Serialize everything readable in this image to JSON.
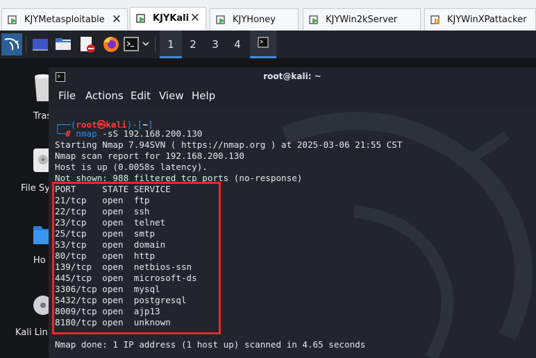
{
  "vm_tabs": [
    {
      "label": "KJYMetasploitable",
      "active": false
    },
    {
      "label": "KJYKali",
      "active": true
    },
    {
      "label": "KJYHoney",
      "active": false
    },
    {
      "label": "KJYWin2kServer",
      "active": false
    },
    {
      "label": "KJYWinXPattacker",
      "active": false
    }
  ],
  "close_glyph": "✕",
  "workspaces": [
    "1",
    "2",
    "3",
    "4"
  ],
  "desktop": {
    "icons": [
      {
        "label": "Trash"
      },
      {
        "label": "File Sys"
      },
      {
        "label": "Ho"
      },
      {
        "label": "Kali Lin"
      }
    ]
  },
  "terminal": {
    "title": "root@kali: ~",
    "menu": [
      "File",
      "Actions",
      "Edit",
      "View",
      "Help"
    ],
    "prompt": {
      "open": "┌──(",
      "user": "root",
      "at": "㉿",
      "host": "kali",
      "close": ")-[",
      "dir": "~",
      "end": "]",
      "line2": "└─",
      "hash": "#",
      "cmd": "nmap",
      "args": "-sS 192.168.200.130"
    },
    "output": [
      "Starting Nmap 7.94SVN ( https://nmap.org ) at 2025-03-06 21:55 CST",
      "Nmap scan report for 192.168.200.130",
      "Host is up (0.0058s latency).",
      "Not shown: 988 filtered tcp ports (no-response)"
    ],
    "table_header": "PORT     STATE SERVICE",
    "ports": [
      "21/tcp   open  ftp",
      "22/tcp   open  ssh",
      "23/tcp   open  telnet",
      "25/tcp   open  smtp",
      "53/tcp   open  domain",
      "80/tcp   open  http",
      "139/tcp  open  netbios-ssn",
      "445/tcp  open  microsoft-ds",
      "3306/tcp open  mysql",
      "5432/tcp open  postgresql",
      "8009/tcp open  ajp13",
      "8180/tcp open  unknown"
    ],
    "footer": "Nmap done: 1 IP address (1 host up) scanned in 4.65 seconds"
  },
  "colors": {
    "highlight": "#ea2a2a",
    "prompt_blue": "#2e8de6",
    "prompt_red": "#ff3b3b"
  }
}
